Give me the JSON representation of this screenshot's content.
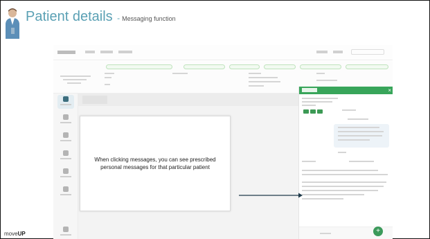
{
  "slide": {
    "title": "Patient details",
    "subtitle": "Messaging function"
  },
  "callout": {
    "text": "When clicking messages, you can see prescribed personal messages for that particular patient"
  },
  "brand": {
    "prefix": "move",
    "suffix": "UP"
  },
  "icons": {
    "avatar": "presenter-avatar-icon",
    "arrow": "arrow-right-icon",
    "fab": "plus-icon",
    "close": "close-icon"
  },
  "colors": {
    "title": "#5aa0b4",
    "accent_green": "#38a55a",
    "arrow": "#1f3a4a"
  }
}
